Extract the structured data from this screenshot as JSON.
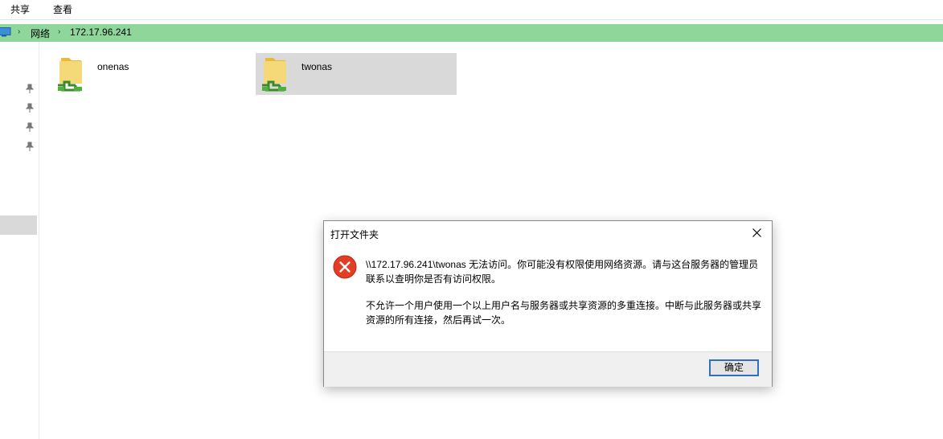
{
  "ribbon": {
    "tabs": [
      "共享",
      "查看"
    ]
  },
  "address": {
    "location_icon": "computer-icon",
    "breadcrumbs": [
      "网络",
      "172.17.96.241"
    ]
  },
  "nav": {
    "pinned_icon": "pin-icon"
  },
  "folders": [
    {
      "name": "onenas",
      "icon": "network-share-folder-icon",
      "selected": false
    },
    {
      "name": "twonas",
      "icon": "network-share-folder-icon",
      "selected": true
    }
  ],
  "dialog": {
    "title": "打开文件夹",
    "icon": "error-icon",
    "message1": "\\\\172.17.96.241\\twonas 无法访问。你可能没有权限使用网络资源。请与这台服务器的管理员联系以查明你是否有访问权限。",
    "message2": "不允许一个用户使用一个以上用户名与服务器或共享资源的多重连接。中断与此服务器或共享资源的所有连接，然后再试一次。",
    "ok_label": "确定"
  },
  "colors": {
    "address_bar": "#8fd69a",
    "selection": "#d9d9d9",
    "error": "#e53c24",
    "button_border": "#2d6fc1"
  }
}
